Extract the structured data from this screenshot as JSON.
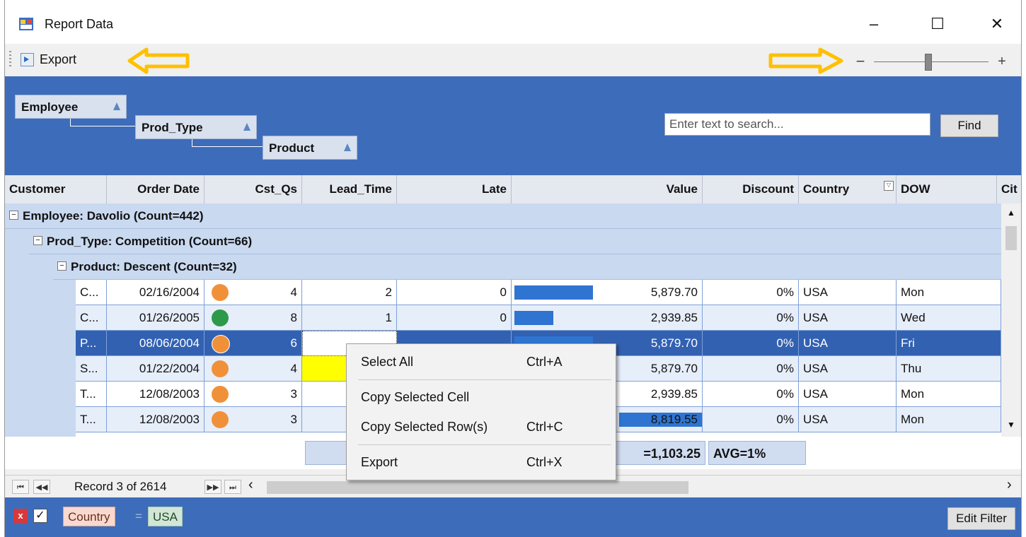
{
  "window": {
    "title": "Report Data",
    "min": "–",
    "max": "☐",
    "close": "✕"
  },
  "toolbar": {
    "export_label": "Export",
    "zoom_minus": "−",
    "zoom_plus": "+",
    "zoom_level": 0.55
  },
  "group_panel": {
    "chips": [
      "Employee",
      "Prod_Type",
      "Product"
    ]
  },
  "search": {
    "placeholder": "Enter text to search...",
    "find_label": "Find"
  },
  "columns": [
    "Customer",
    "Order Date",
    "Cst_Qs",
    "Lead_Time",
    "Late",
    "Value",
    "Discount",
    "Country",
    "DOW",
    "Cit"
  ],
  "groups": {
    "employee": "Employee: Davolio (Count=442)",
    "prod_type": "Prod_Type: Competition (Count=66)",
    "product": "Product: Descent (Count=32)",
    "expander": "−"
  },
  "rows": [
    {
      "customer": "C...",
      "date": "02/16/2004",
      "status": "orange",
      "qs": "4",
      "lead": "2",
      "late": "0",
      "value": "5,879.70",
      "bar": 0.67,
      "discount": "0%",
      "country": "USA",
      "dow": "Mon"
    },
    {
      "customer": "C...",
      "date": "01/26/2005",
      "status": "green",
      "qs": "8",
      "lead": "1",
      "late": "0",
      "value": "2,939.85",
      "bar": 0.33,
      "discount": "0%",
      "country": "USA",
      "dow": "Wed"
    },
    {
      "customer": "P...",
      "date": "08/06/2004",
      "status": "orange",
      "qs": "6",
      "lead": "",
      "late": "",
      "value": "5,879.70",
      "bar": 0.67,
      "discount": "0%",
      "country": "USA",
      "dow": "Fri"
    },
    {
      "customer": "S...",
      "date": "01/22/2004",
      "status": "orange",
      "qs": "4",
      "lead": "",
      "late": "",
      "value": "5,879.70",
      "bar": 0.67,
      "discount": "0%",
      "country": "USA",
      "dow": "Thu"
    },
    {
      "customer": "T...",
      "date": "12/08/2003",
      "status": "orange",
      "qs": "3",
      "lead": "",
      "late": "",
      "value": "2,939.85",
      "bar": 0.33,
      "discount": "0%",
      "country": "USA",
      "dow": "Mon"
    },
    {
      "customer": "T...",
      "date": "12/08/2003",
      "status": "orange",
      "qs": "3",
      "lead": "",
      "late": "",
      "value": "8,819.55",
      "bar": 1.0,
      "discount": "0%",
      "country": "USA",
      "dow": "Mon"
    }
  ],
  "totals": {
    "value": "=1,103.25",
    "discount": "AVG=1%"
  },
  "navigator": {
    "record_text": "Record 3 of 2614",
    "first": "⏮",
    "prev": "◀◀",
    "next": "▶▶",
    "last": "⏭",
    "left": "‹",
    "right": "›"
  },
  "filter": {
    "column": "Country",
    "operator": "=",
    "value": "USA",
    "edit_label": "Edit Filter",
    "clear": "x",
    "enabled": "✓"
  },
  "context_menu": {
    "items": [
      {
        "label": "Select All",
        "shortcut": "Ctrl+A"
      },
      {
        "label": "Copy Selected Cell",
        "shortcut": ""
      },
      {
        "label": "Copy Selected Row(s)",
        "shortcut": "Ctrl+C"
      },
      {
        "label": "Export",
        "shortcut": "Ctrl+X"
      }
    ]
  },
  "colors": {
    "accent": "#3d6cba",
    "selection": "#3261b2",
    "status_orange": "#f0913a",
    "status_green": "#2c9a48",
    "bar": "#2f74d0",
    "arrow": "#ffc000",
    "highlight": "#ffff00"
  }
}
